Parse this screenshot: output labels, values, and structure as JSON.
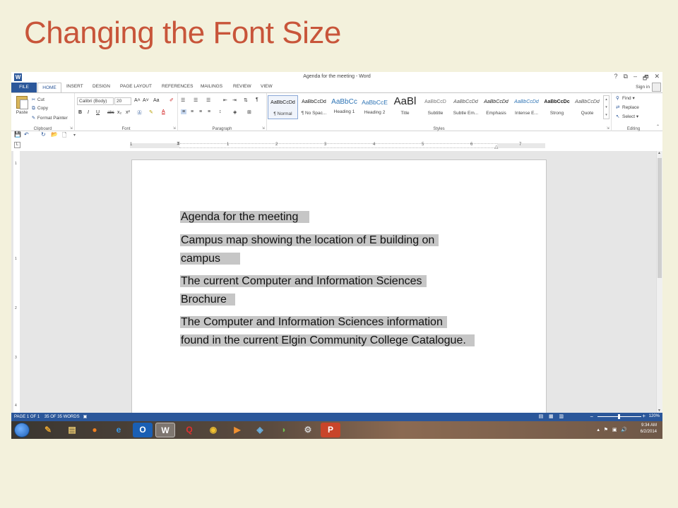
{
  "slide": {
    "title": "Changing the Font Size"
  },
  "window": {
    "title": "Agenda for the meeting - Word",
    "help": "?",
    "ribbon_opts": "⧉",
    "minimize": "–",
    "restore": "🗗",
    "close": "✕"
  },
  "tabs": [
    "FILE",
    "HOME",
    "INSERT",
    "DESIGN",
    "PAGE LAYOUT",
    "REFERENCES",
    "MAILINGS",
    "REVIEW",
    "VIEW"
  ],
  "signin": "Sign in",
  "clipboard": {
    "paste": "Paste",
    "cut": "Cut",
    "copy": "Copy",
    "format_painter": "Format Painter",
    "label": "Clipboard"
  },
  "font": {
    "name": "Calibri (Body)",
    "size": "20",
    "grow": "A˄",
    "shrink": "A˅",
    "case": "Aa",
    "bold": "B",
    "italic": "I",
    "underline": "U",
    "strike": "abc",
    "sub": "x₂",
    "sup": "x²",
    "label": "Font"
  },
  "paragraph": {
    "label": "Paragraph",
    "pilcrow": "¶"
  },
  "styles": {
    "label": "Styles",
    "items": [
      {
        "preview": "AaBbCcDd",
        "name": "¶ Normal"
      },
      {
        "preview": "AaBbCcDd",
        "name": "¶ No Spac..."
      },
      {
        "preview": "AaBbCc",
        "name": "Heading 1"
      },
      {
        "preview": "AaBbCcE",
        "name": "Heading 2"
      },
      {
        "preview": "AaBl",
        "name": "Title"
      },
      {
        "preview": "AaBbCcD",
        "name": "Subtitle"
      },
      {
        "preview": "AaBbCcDd",
        "name": "Subtle Em..."
      },
      {
        "preview": "AaBbCcDd",
        "name": "Emphasis"
      },
      {
        "preview": "AaBbCcDd",
        "name": "Intense E..."
      },
      {
        "preview": "AaBbCcDc",
        "name": "Strong"
      },
      {
        "preview": "AaBbCcDd",
        "name": "Quote"
      }
    ]
  },
  "editing": {
    "find": "Find",
    "replace": "Replace",
    "select": "Select",
    "label": "Editing"
  },
  "ruler": {
    "h_numbers": [
      "1",
      "1",
      "2",
      "3",
      "4",
      "5",
      "6",
      "7"
    ],
    "v_numbers": [
      "1",
      "1",
      "2",
      "3",
      "4"
    ],
    "corner": "L"
  },
  "document": {
    "paragraphs": [
      [
        "Agenda for the meeting"
      ],
      [
        "Campus map showing the location of E building on",
        "campus"
      ],
      [
        "The current Computer and Information Sciences",
        "Brochure"
      ],
      [
        "The Computer and Information Sciences information",
        "found in the current Elgin Community College Catalogue."
      ]
    ]
  },
  "status": {
    "page": "PAGE 1 OF 1",
    "words": "35 OF 35 WORDS",
    "zoom": "120%",
    "zoom_level_percent": 120
  },
  "taskbar": {
    "apps": [
      {
        "name": "ie",
        "glyph": "e"
      },
      {
        "name": "outlook",
        "glyph": "O"
      },
      {
        "name": "word",
        "glyph": "W"
      },
      {
        "name": "acrobat",
        "glyph": "Q"
      },
      {
        "name": "chrome",
        "glyph": "◉"
      },
      {
        "name": "media",
        "glyph": "▶"
      },
      {
        "name": "powerpoint",
        "glyph": "P"
      }
    ],
    "time": "9:34 AM",
    "date": "6/2/2014"
  },
  "colors": {
    "accent": "#2b579a",
    "title": "#c8553a",
    "selection": "#c6c6c6"
  }
}
